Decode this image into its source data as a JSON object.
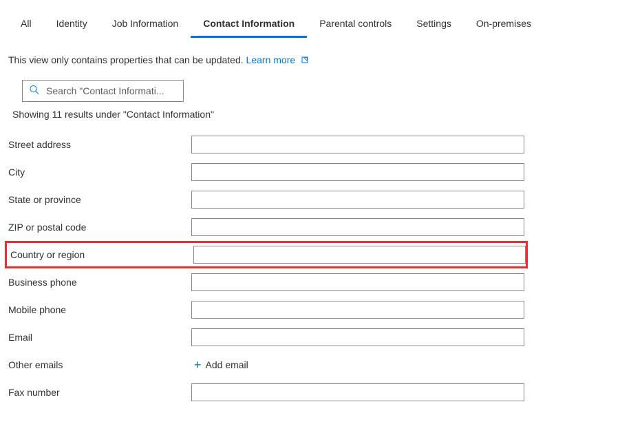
{
  "tabs": [
    {
      "label": "All",
      "active": false
    },
    {
      "label": "Identity",
      "active": false
    },
    {
      "label": "Job Information",
      "active": false
    },
    {
      "label": "Contact Information",
      "active": true
    },
    {
      "label": "Parental controls",
      "active": false
    },
    {
      "label": "Settings",
      "active": false
    },
    {
      "label": "On-premises",
      "active": false
    }
  ],
  "info": {
    "text": "This view only contains properties that can be updated.",
    "learn_more": "Learn more"
  },
  "search": {
    "placeholder": "Search \"Contact Informati..."
  },
  "results_text": "Showing 11 results under \"Contact Information\"",
  "fields": {
    "street_address": {
      "label": "Street address",
      "value": ""
    },
    "city": {
      "label": "City",
      "value": ""
    },
    "state": {
      "label": "State or province",
      "value": ""
    },
    "zip": {
      "label": "ZIP or postal code",
      "value": ""
    },
    "country": {
      "label": "Country or region",
      "value": "",
      "highlighted": true
    },
    "business_phone": {
      "label": "Business phone",
      "value": ""
    },
    "mobile_phone": {
      "label": "Mobile phone",
      "value": ""
    },
    "email": {
      "label": "Email",
      "value": ""
    },
    "other_emails": {
      "label": "Other emails",
      "add_label": "Add email"
    },
    "fax": {
      "label": "Fax number",
      "value": ""
    }
  }
}
